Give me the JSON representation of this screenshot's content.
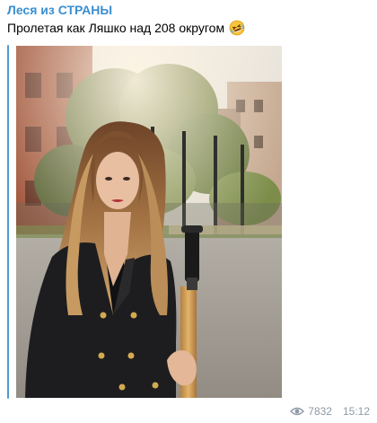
{
  "channel": {
    "name": "Леся из СТРАНЫ"
  },
  "message": {
    "text": "Пролетая как Ляшко над 208 округом",
    "emoji_icon": "rofl-face-icon"
  },
  "photo": {
    "icon": "post-photo"
  },
  "footer": {
    "views": "7832",
    "time": "15:12",
    "views_icon": "eye-icon"
  },
  "colors": {
    "channel_name": "#3a8fd1",
    "quote_bar": "#4a9bd9",
    "meta": "#8e9aa6"
  }
}
